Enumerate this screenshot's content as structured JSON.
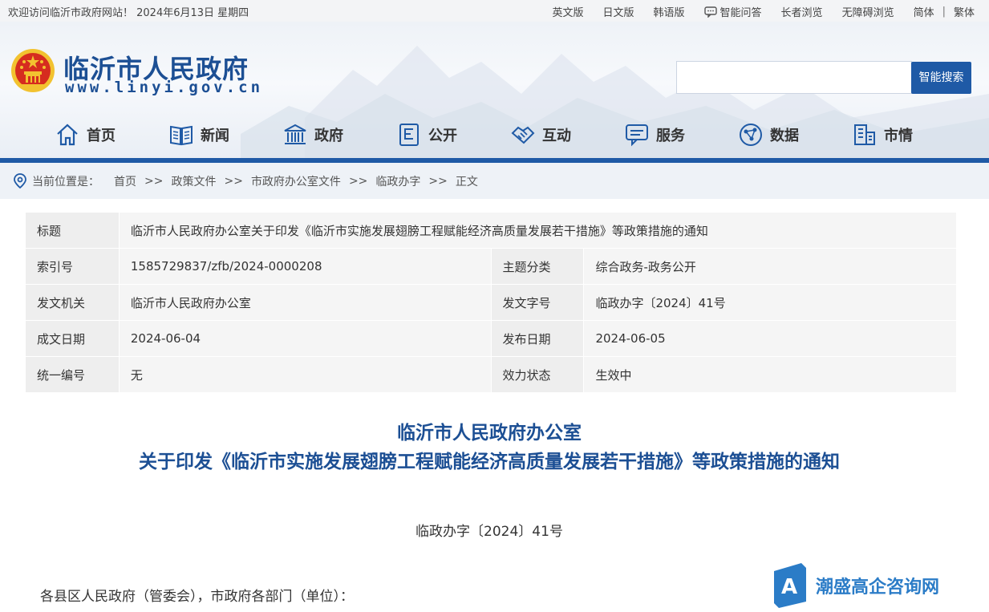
{
  "topbar": {
    "welcome": "欢迎访问临沂市政府网站！ 2024年6月13日  星期四",
    "links": [
      "英文版",
      "日文版",
      "韩语版",
      "智能问答",
      "长者浏览",
      "无障碍浏览"
    ],
    "lang_simplified": "简体",
    "lang_separator": "|",
    "lang_traditional": "繁体"
  },
  "header": {
    "title": "临沂市人民政府",
    "url": "www.linyi.gov.cn",
    "search_placeholder": "",
    "search_button": "智能搜索"
  },
  "nav": [
    {
      "label": "首页",
      "icon": "home-icon"
    },
    {
      "label": "新闻",
      "icon": "news-icon"
    },
    {
      "label": "政府",
      "icon": "government-building-icon"
    },
    {
      "label": "公开",
      "icon": "document-icon"
    },
    {
      "label": "互动",
      "icon": "handshake-icon"
    },
    {
      "label": "服务",
      "icon": "service-chat-icon"
    },
    {
      "label": "数据",
      "icon": "data-icon"
    },
    {
      "label": "市情",
      "icon": "city-buildings-icon"
    }
  ],
  "breadcrumb": {
    "prefix": "当前位置是：",
    "items": [
      "首页",
      "政策文件",
      "市政府办公室文件",
      "临政办字",
      "正文"
    ],
    "separator": ">>"
  },
  "info": {
    "title_label": "标题",
    "title_value": "临沂市人民政府办公室关于印发《临沂市实施发展翅膀工程赋能经济高质量发展若干措施》等政策措施的通知",
    "rows": [
      {
        "l1": "索引号",
        "v1": "1585729837/zfb/2024-0000208",
        "l2": "主题分类",
        "v2": "综合政务-政务公开"
      },
      {
        "l1": "发文机关",
        "v1": "临沂市人民政府办公室",
        "l2": "发文字号",
        "v2": "临政办字〔2024〕41号"
      },
      {
        "l1": "成文日期",
        "v1": "2024-06-04",
        "l2": "发布日期",
        "v2": "2024-06-05"
      },
      {
        "l1": "统一编号",
        "v1": "无",
        "l2": "效力状态",
        "v2": "生效中"
      }
    ]
  },
  "document": {
    "title_line1": "临沂市人民政府办公室",
    "title_line2": "关于印发《临沂市实施发展翅膀工程赋能经济高质量发展若干措施》等政策措施的通知",
    "number": "临政办字〔2024〕41号",
    "salutation": "各县区人民政府（管委会），市政府各部门（单位）："
  },
  "watermark": {
    "text": "潮盛高企咨询网",
    "logo_letter": "A"
  },
  "colors": {
    "primary": "#1f5aa6",
    "title_blue": "#1c4f94",
    "emblem_red": "#d62c1f",
    "emblem_gold": "#f2c230"
  }
}
